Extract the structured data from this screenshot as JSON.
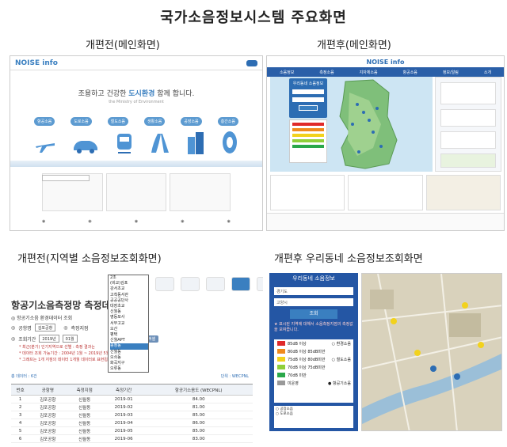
{
  "title": "국가소음정보시스템 주요화면",
  "captions": {
    "old_main": "개편전(메인화면)",
    "new_main": "개편후(메인화면)",
    "old_regional": "개편전(지역별 소음정보조회화면)",
    "new_neighborhood": "개편후 우리동네 소음정보조회화면"
  },
  "old_main": {
    "logo": "NOISE info",
    "slogan_prefix": "조용하고 건강한 ",
    "slogan_highlight": "도시환경",
    "slogan_suffix": " 함께 합니다.",
    "categories": [
      "항공소음",
      "도로소음",
      "철도소음",
      "생활소음",
      "공장소음",
      "층간소음"
    ]
  },
  "new_main": {
    "logo": "NOISE info",
    "nav": [
      "소음정보",
      "측정소음",
      "지자체소음",
      "항공소음",
      "정보/알림",
      "소개"
    ],
    "search_title": "우리동네 소음정보"
  },
  "old_regional": {
    "heading": "항공기소음측정망 측정데",
    "subheading": "◎ 항공기소음 환경데이터 조회",
    "airport_label": "공항명",
    "airport_value": "김포공항",
    "site_label": "측정지점",
    "period_label": "조회기간",
    "year_value": "2019년",
    "month_value": "01월",
    "search_btn": "조회",
    "excel_btn": "엑셀",
    "notes": [
      "* 최근(분기) 인기지역으로 선별 : 측정 결과는",
      "* 데이터 조회 가능기간 : 2004년 1월 ~ 2019년 5월",
      "* 그래프는 1개 지점의 데이터 1개월 데이터로 표현됩니다."
    ],
    "dropdown_options": [
      "2조",
      "(비교)김포",
      "강서초교",
      "고척동서관",
      "공공공단사",
      "대장초교",
      "신월동",
      "영등포사",
      "서무고교",
      "오산",
      "평택",
      "신월APT",
      "송정동",
      "신월동",
      "오쇠동",
      "화곡지구",
      "오류동"
    ],
    "count_label": "총 데이터 : 6건",
    "unit_label": "단위 : WECPNL",
    "table_headers": [
      "번호",
      "공항명",
      "측정지점",
      "측정기간",
      "항공기소음도 (WECPNL)"
    ],
    "rows": [
      [
        "1",
        "김포공항",
        "신월동",
        "2019-01",
        "84.00"
      ],
      [
        "2",
        "김포공항",
        "신월동",
        "2019-02",
        "81.00"
      ],
      [
        "3",
        "김포공항",
        "신월동",
        "2019-03",
        "85.00"
      ],
      [
        "4",
        "김포공항",
        "신월동",
        "2019-04",
        "86.00"
      ],
      [
        "5",
        "김포공항",
        "신월동",
        "2019-05",
        "85.00"
      ],
      [
        "6",
        "김포공항",
        "신월동",
        "2019-06",
        "83.00"
      ]
    ]
  },
  "new_neighborhood": {
    "title": "우리동네 소음정보",
    "field1": "경기도",
    "field2": "고양시",
    "search_btn": "조회",
    "notice": "★ 표시된 지역에 대해서 소음측정지점의 측정값을 보여줍니다.",
    "legend": [
      {
        "label": "85dB 이상",
        "color": "#e02a2a"
      },
      {
        "label": "80dB 이상 85dB미만",
        "color": "#f08a1c"
      },
      {
        "label": "75dB 이상 80dB미만",
        "color": "#f2d21c"
      },
      {
        "label": "70dB 이상 75dB미만",
        "color": "#8fcf3a"
      },
      {
        "label": "70dB 미만",
        "color": "#2aa84a"
      },
      {
        "label": "미운영",
        "color": "#999999"
      }
    ],
    "radio_options": [
      "환경소음",
      "철도소음",
      "항공기소음",
      "공장소음",
      "도로소음"
    ]
  }
}
